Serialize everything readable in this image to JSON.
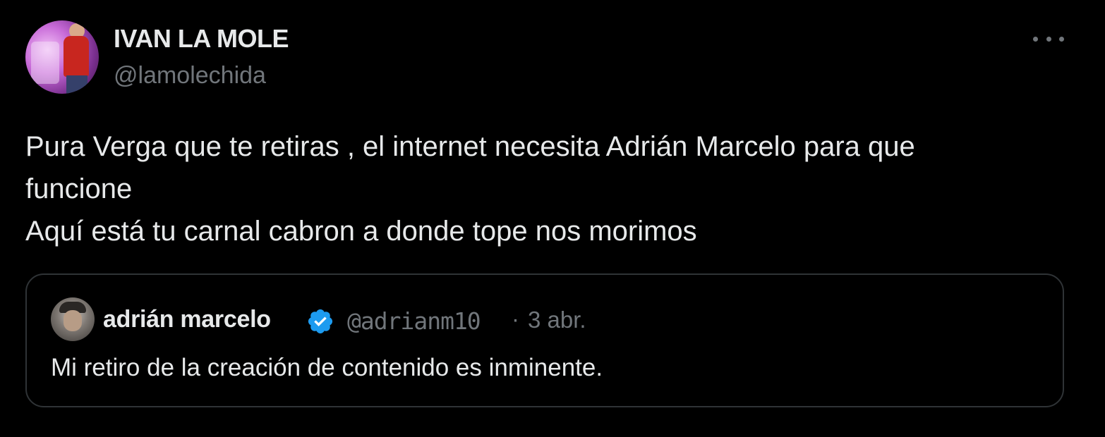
{
  "tweet": {
    "author": {
      "display_name": "IVAN LA MOLE",
      "handle": "@lamolechida"
    },
    "text_lines": [
      "Pura Verga que te retiras , el internet necesita Adrián Marcelo para que",
      "funcione",
      "Aquí está tu carnal cabron a donde tope nos morimos"
    ],
    "more_icon": "more-horizontal-icon",
    "quoted": {
      "display_name": "adrián marcelo",
      "verified_icon": "verified-badge-icon",
      "handle": "@adrianm10",
      "separator": "·",
      "date": "3 abr.",
      "text": "Mi retiro de la creación de contenido es inminente."
    }
  },
  "colors": {
    "background": "#000000",
    "primary_text": "#e7e9ea",
    "secondary_text": "#71767b",
    "border": "#2f3336",
    "verified": "#1d9bf0"
  }
}
